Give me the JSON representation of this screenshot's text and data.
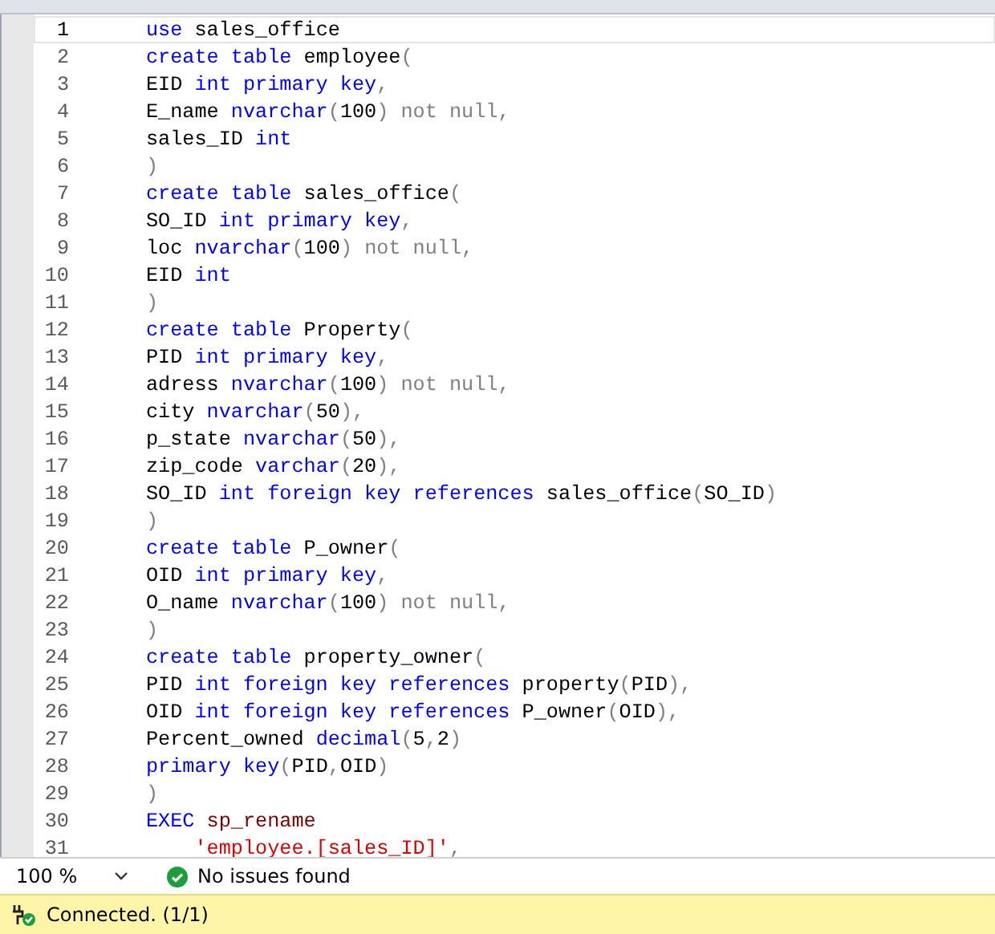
{
  "editor": {
    "lines": [
      {
        "number": "1",
        "current": true,
        "tokens": [
          {
            "text": "use",
            "kind": "keyword"
          },
          {
            "text": " sales_office",
            "kind": "plain"
          }
        ]
      },
      {
        "number": "2",
        "current": false,
        "tokens": [
          {
            "text": "create table",
            "kind": "keyword"
          },
          {
            "text": " employee",
            "kind": "plain"
          },
          {
            "text": "(",
            "kind": "punct"
          }
        ]
      },
      {
        "number": "3",
        "current": false,
        "tokens": [
          {
            "text": "EID ",
            "kind": "plain"
          },
          {
            "text": "int primary key",
            "kind": "keyword"
          },
          {
            "text": ",",
            "kind": "punct"
          }
        ]
      },
      {
        "number": "4",
        "current": false,
        "tokens": [
          {
            "text": "E_name ",
            "kind": "plain"
          },
          {
            "text": "nvarchar",
            "kind": "keyword"
          },
          {
            "text": "(",
            "kind": "punct"
          },
          {
            "text": "100",
            "kind": "plain"
          },
          {
            "text": ") not null,",
            "kind": "punct"
          }
        ]
      },
      {
        "number": "5",
        "current": false,
        "tokens": [
          {
            "text": "sales_ID ",
            "kind": "plain"
          },
          {
            "text": "int",
            "kind": "keyword"
          }
        ]
      },
      {
        "number": "6",
        "current": false,
        "tokens": [
          {
            "text": ")",
            "kind": "punct"
          }
        ]
      },
      {
        "number": "7",
        "current": false,
        "tokens": [
          {
            "text": "create table",
            "kind": "keyword"
          },
          {
            "text": " sales_office",
            "kind": "plain"
          },
          {
            "text": "(",
            "kind": "punct"
          }
        ]
      },
      {
        "number": "8",
        "current": false,
        "tokens": [
          {
            "text": "SO_ID ",
            "kind": "plain"
          },
          {
            "text": "int primary key",
            "kind": "keyword"
          },
          {
            "text": ",",
            "kind": "punct"
          }
        ]
      },
      {
        "number": "9",
        "current": false,
        "tokens": [
          {
            "text": "loc ",
            "kind": "plain"
          },
          {
            "text": "nvarchar",
            "kind": "keyword"
          },
          {
            "text": "(",
            "kind": "punct"
          },
          {
            "text": "100",
            "kind": "plain"
          },
          {
            "text": ") not null,",
            "kind": "punct"
          }
        ]
      },
      {
        "number": "10",
        "current": false,
        "tokens": [
          {
            "text": "EID ",
            "kind": "plain"
          },
          {
            "text": "int",
            "kind": "keyword"
          }
        ]
      },
      {
        "number": "11",
        "current": false,
        "tokens": [
          {
            "text": ")",
            "kind": "punct"
          }
        ]
      },
      {
        "number": "12",
        "current": false,
        "tokens": [
          {
            "text": "create table",
            "kind": "keyword"
          },
          {
            "text": " Property",
            "kind": "plain"
          },
          {
            "text": "(",
            "kind": "punct"
          }
        ]
      },
      {
        "number": "13",
        "current": false,
        "tokens": [
          {
            "text": "PID ",
            "kind": "plain"
          },
          {
            "text": "int primary key",
            "kind": "keyword"
          },
          {
            "text": ",",
            "kind": "punct"
          }
        ]
      },
      {
        "number": "14",
        "current": false,
        "tokens": [
          {
            "text": "adress ",
            "kind": "plain"
          },
          {
            "text": "nvarchar",
            "kind": "keyword"
          },
          {
            "text": "(",
            "kind": "punct"
          },
          {
            "text": "100",
            "kind": "plain"
          },
          {
            "text": ") not null,",
            "kind": "punct"
          }
        ]
      },
      {
        "number": "15",
        "current": false,
        "tokens": [
          {
            "text": "city ",
            "kind": "plain"
          },
          {
            "text": "nvarchar",
            "kind": "keyword"
          },
          {
            "text": "(",
            "kind": "punct"
          },
          {
            "text": "50",
            "kind": "plain"
          },
          {
            "text": "),",
            "kind": "punct"
          }
        ]
      },
      {
        "number": "16",
        "current": false,
        "tokens": [
          {
            "text": "p_state ",
            "kind": "plain"
          },
          {
            "text": "nvarchar",
            "kind": "keyword"
          },
          {
            "text": "(",
            "kind": "punct"
          },
          {
            "text": "50",
            "kind": "plain"
          },
          {
            "text": "),",
            "kind": "punct"
          }
        ]
      },
      {
        "number": "17",
        "current": false,
        "tokens": [
          {
            "text": "zip_code ",
            "kind": "plain"
          },
          {
            "text": "varchar",
            "kind": "keyword"
          },
          {
            "text": "(",
            "kind": "punct"
          },
          {
            "text": "20",
            "kind": "plain"
          },
          {
            "text": "),",
            "kind": "punct"
          }
        ]
      },
      {
        "number": "18",
        "current": false,
        "tokens": [
          {
            "text": "SO_ID ",
            "kind": "plain"
          },
          {
            "text": "int foreign key references",
            "kind": "keyword"
          },
          {
            "text": " sales_office",
            "kind": "plain"
          },
          {
            "text": "(",
            "kind": "punct"
          },
          {
            "text": "SO_ID",
            "kind": "plain"
          },
          {
            "text": ")",
            "kind": "punct"
          }
        ]
      },
      {
        "number": "19",
        "current": false,
        "tokens": [
          {
            "text": ")",
            "kind": "punct"
          }
        ]
      },
      {
        "number": "20",
        "current": false,
        "tokens": [
          {
            "text": "create table",
            "kind": "keyword"
          },
          {
            "text": " P_owner",
            "kind": "plain"
          },
          {
            "text": "(",
            "kind": "punct"
          }
        ]
      },
      {
        "number": "21",
        "current": false,
        "tokens": [
          {
            "text": "OID ",
            "kind": "plain"
          },
          {
            "text": "int primary key",
            "kind": "keyword"
          },
          {
            "text": ",",
            "kind": "punct"
          }
        ]
      },
      {
        "number": "22",
        "current": false,
        "tokens": [
          {
            "text": "O_name ",
            "kind": "plain"
          },
          {
            "text": "nvarchar",
            "kind": "keyword"
          },
          {
            "text": "(",
            "kind": "punct"
          },
          {
            "text": "100",
            "kind": "plain"
          },
          {
            "text": ") not null,",
            "kind": "punct"
          }
        ]
      },
      {
        "number": "23",
        "current": false,
        "tokens": [
          {
            "text": ")",
            "kind": "punct"
          }
        ]
      },
      {
        "number": "24",
        "current": false,
        "tokens": [
          {
            "text": "create table",
            "kind": "keyword"
          },
          {
            "text": " property_owner",
            "kind": "plain"
          },
          {
            "text": "(",
            "kind": "punct"
          }
        ]
      },
      {
        "number": "25",
        "current": false,
        "tokens": [
          {
            "text": "PID ",
            "kind": "plain"
          },
          {
            "text": "int foreign key references",
            "kind": "keyword"
          },
          {
            "text": " property",
            "kind": "plain"
          },
          {
            "text": "(",
            "kind": "punct"
          },
          {
            "text": "PID",
            "kind": "plain"
          },
          {
            "text": "),",
            "kind": "punct"
          }
        ]
      },
      {
        "number": "26",
        "current": false,
        "tokens": [
          {
            "text": "OID ",
            "kind": "plain"
          },
          {
            "text": "int foreign key references",
            "kind": "keyword"
          },
          {
            "text": " P_owner",
            "kind": "plain"
          },
          {
            "text": "(",
            "kind": "punct"
          },
          {
            "text": "OID",
            "kind": "plain"
          },
          {
            "text": "),",
            "kind": "punct"
          }
        ]
      },
      {
        "number": "27",
        "current": false,
        "tokens": [
          {
            "text": "Percent_owned ",
            "kind": "plain"
          },
          {
            "text": "decimal",
            "kind": "keyword"
          },
          {
            "text": "(",
            "kind": "punct"
          },
          {
            "text": "5",
            "kind": "plain"
          },
          {
            "text": ",",
            "kind": "punct"
          },
          {
            "text": "2",
            "kind": "plain"
          },
          {
            "text": ")",
            "kind": "punct"
          }
        ]
      },
      {
        "number": "28",
        "current": false,
        "tokens": [
          {
            "text": "primary key",
            "kind": "keyword"
          },
          {
            "text": "(",
            "kind": "punct"
          },
          {
            "text": "PID",
            "kind": "plain"
          },
          {
            "text": ",",
            "kind": "punct"
          },
          {
            "text": "OID",
            "kind": "plain"
          },
          {
            "text": ")",
            "kind": "punct"
          }
        ]
      },
      {
        "number": "29",
        "current": false,
        "tokens": [
          {
            "text": ")",
            "kind": "punct"
          }
        ]
      },
      {
        "number": "30",
        "current": false,
        "tokens": [
          {
            "text": "EXEC",
            "kind": "keyword"
          },
          {
            "text": " sp_rename",
            "kind": "system"
          }
        ]
      },
      {
        "number": "31",
        "current": false,
        "tokens": [
          {
            "text": "    'employee.[sales_ID]'",
            "kind": "string"
          },
          {
            "text": ",",
            "kind": "punct"
          }
        ]
      }
    ]
  },
  "zoom": {
    "value": "100 %"
  },
  "issues": {
    "text": "No issues found",
    "ok": true
  },
  "status_bar": {
    "text": "Connected. (1/1)"
  }
}
